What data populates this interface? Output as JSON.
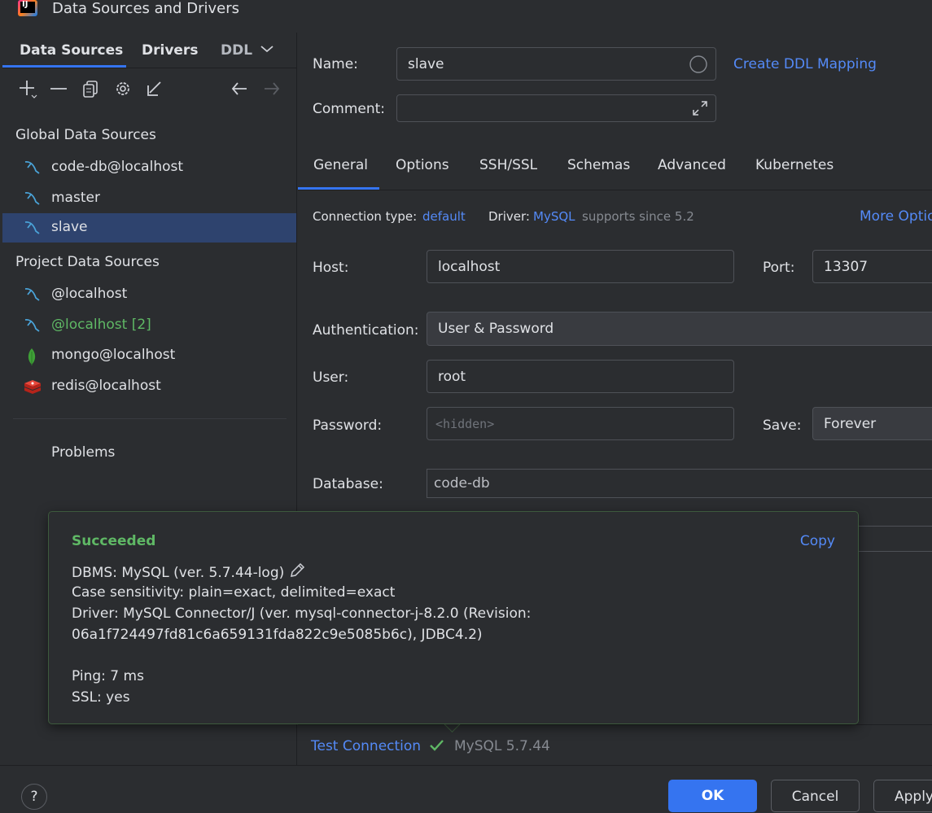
{
  "window": {
    "title": "Data Sources and Drivers"
  },
  "left": {
    "tabs": [
      "Data Sources",
      "Drivers",
      "DDL"
    ],
    "toolbar": {
      "add": "+",
      "remove": "—",
      "duplicate": "⧉",
      "settings": "⚙",
      "import": "↙",
      "back": "←",
      "forward": "→"
    },
    "global_header": "Global Data Sources",
    "global_items": [
      {
        "label": "code-db@localhost",
        "icon": "mysql-dolphin-icon"
      },
      {
        "label": "master",
        "icon": "mysql-dolphin-icon"
      },
      {
        "label": "slave",
        "icon": "mysql-dolphin-icon",
        "selected": true
      }
    ],
    "project_header": "Project Data Sources",
    "project_items": [
      {
        "label": "@localhost",
        "icon": "mysql-dolphin-icon"
      },
      {
        "label": "@localhost [2]",
        "icon": "mysql-dolphin-icon"
      },
      {
        "label": "mongo@localhost",
        "icon": "mongodb-leaf-icon"
      },
      {
        "label": "redis@localhost",
        "icon": "redis-cube-icon"
      }
    ],
    "problems": "Problems"
  },
  "form": {
    "name_label": "Name:",
    "name_value": "slave",
    "create_ddl_mapping": "Create DDL Mapping",
    "comment_label": "Comment:",
    "comment_value": "",
    "tabs": [
      "General",
      "Options",
      "SSH/SSL",
      "Schemas",
      "Advanced",
      "Kubernetes"
    ],
    "connection_type_label": "Connection type:",
    "connection_type_value": "default",
    "driver_label": "Driver:",
    "driver_value": "MySQL",
    "driver_note": "supports since 5.2",
    "more_options": "More Optio",
    "host_label": "Host:",
    "host_value": "localhost",
    "port_label": "Port:",
    "port_value": "13307",
    "auth_label": "Authentication:",
    "auth_value": "User & Password",
    "user_label": "User:",
    "user_value": "root",
    "password_label": "Password:",
    "password_placeholder": "<hidden>",
    "save_label": "Save:",
    "save_value": "Forever",
    "database_label": "Database:",
    "database_value": "code-db"
  },
  "popup": {
    "status": "Succeeded",
    "copy": "Copy",
    "dbms": "DBMS: MySQL (ver. 5.7.44-log)",
    "case_sensitivity": "Case sensitivity: plain=exact, delimited=exact",
    "driver_line1": "Driver: MySQL Connector/J (ver. mysql-connector-j-8.2.0 (Revision:",
    "driver_line2": "06a1f724497fd81c6a659131fda822c9e5085b6c), JDBC4.2)",
    "ping": "Ping: 7 ms",
    "ssl": "SSL: yes"
  },
  "bottom": {
    "test_connection": "Test Connection",
    "test_result": "MySQL 5.7.44",
    "ok": "OK",
    "cancel": "Cancel",
    "apply": "Apply",
    "help": "?"
  },
  "colors": {
    "accent": "#3574f0",
    "link": "#548af7",
    "success": "#5fb865",
    "selection": "#2e436e",
    "mysql": "#4aa3d8",
    "mongo": "#3fa037",
    "redis": "#d82c20"
  }
}
